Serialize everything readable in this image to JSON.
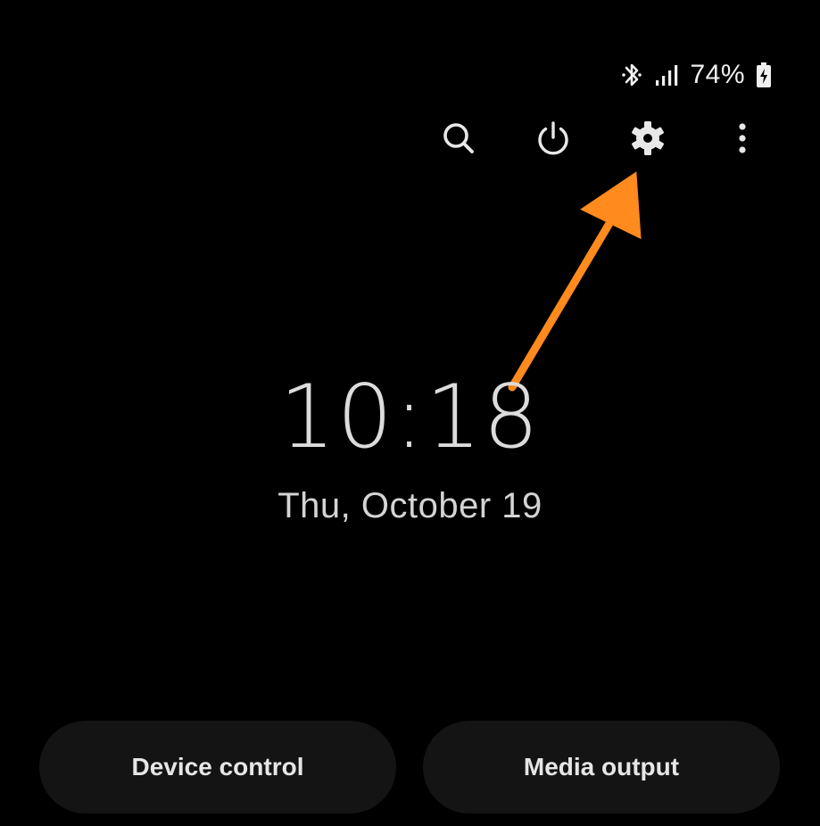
{
  "status_bar": {
    "battery_percent": "74%",
    "icons": [
      "bluetooth-icon",
      "signal-icon",
      "battery-charging-icon"
    ]
  },
  "toolbar": {
    "items": [
      {
        "icon": "search-icon"
      },
      {
        "icon": "power-icon"
      },
      {
        "icon": "settings-gear-icon"
      },
      {
        "icon": "more-options-icon"
      }
    ]
  },
  "clock": {
    "time": "10:18",
    "date": "Thu, October 19"
  },
  "buttons": {
    "device_control": "Device control",
    "media_output": "Media output"
  },
  "annotation": {
    "arrow_color": "#FF8A1E",
    "target": "settings-gear-icon"
  },
  "colors": {
    "background": "#000000",
    "pill_background": "#141414",
    "text": "#E6E6E6"
  }
}
